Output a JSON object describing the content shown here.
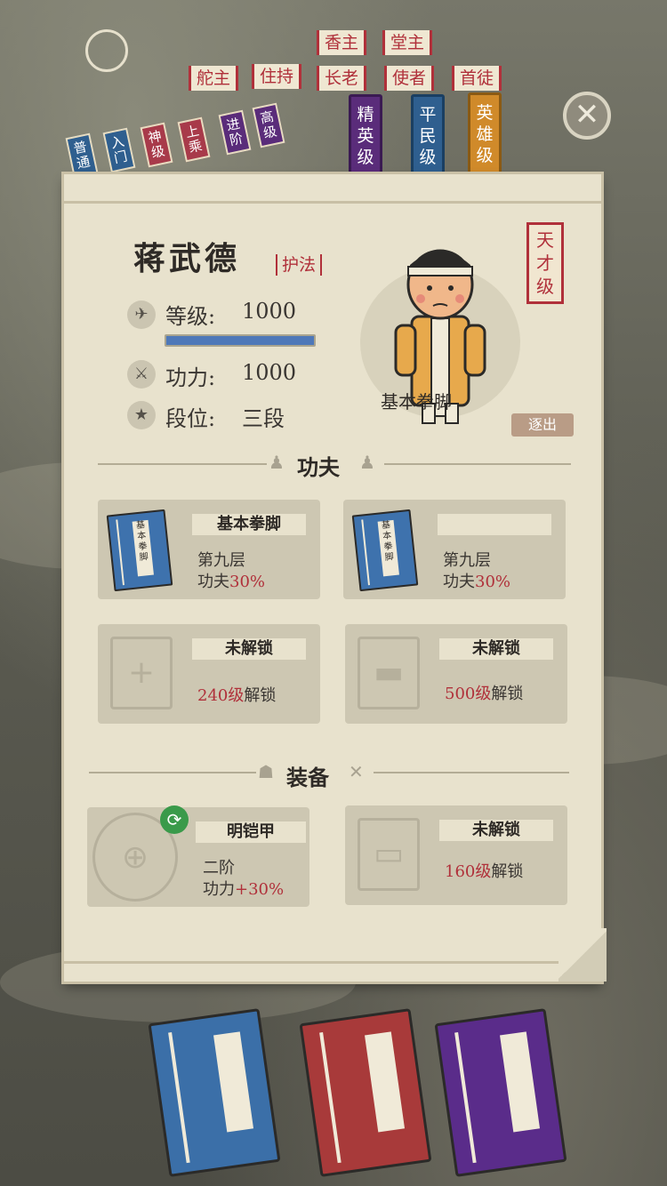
{
  "ranks": {
    "top_row": [
      "香主",
      "堂主"
    ],
    "mid_row": [
      "舵主",
      "住持",
      "长老",
      "使者",
      "首徒"
    ],
    "small_tags": [
      "普通",
      "入门",
      "神级",
      "上乘",
      "进阶",
      "高级"
    ],
    "grade_tags": [
      {
        "label": "精英级",
        "color": "#5a2c7a"
      },
      {
        "label": "平民级",
        "color": "#2f5f8f"
      },
      {
        "label": "英雄级",
        "color": "#d08a2a"
      }
    ]
  },
  "close_icon": "✕",
  "character": {
    "name": "蒋武德",
    "title": "护法",
    "talent": "天才级",
    "skill_caption": "基本拳脚",
    "expel_label": "逐出",
    "level_label": "等级:",
    "level_value": "1000",
    "level_progress": 1.0,
    "power_label": "功力:",
    "power_value": "1000",
    "rank_label": "段位:",
    "rank_value": "三段"
  },
  "sections": {
    "kungfu": "功夫",
    "equipment": "装备"
  },
  "kungfu": [
    {
      "title": "基本拳脚",
      "book_label": "基本拳脚",
      "layer": "第九层",
      "bonus_label": "功夫",
      "bonus_value": "30%"
    },
    {
      "title": "",
      "book_label": "基本拳脚",
      "layer": "第九层",
      "bonus_label": "功夫",
      "bonus_value": "30%"
    },
    {
      "title": "未解锁",
      "unlock_level": "240级",
      "unlock_suffix": "解锁"
    },
    {
      "title": "未解锁",
      "unlock_level": "500级",
      "unlock_suffix": "解锁"
    }
  ],
  "equipment": [
    {
      "title": "明铠甲",
      "tier": "二阶",
      "bonus_label": "功力",
      "bonus_value": "+30%"
    },
    {
      "title": "未解锁",
      "unlock_level": "160级",
      "unlock_suffix": "解锁"
    }
  ],
  "bottom_books": [
    {
      "color": "#3b6fa8",
      "name": "blue-book"
    },
    {
      "color": "#a83a3a",
      "name": "red-book"
    },
    {
      "color": "#5a2c8a",
      "name": "purple-book"
    }
  ]
}
